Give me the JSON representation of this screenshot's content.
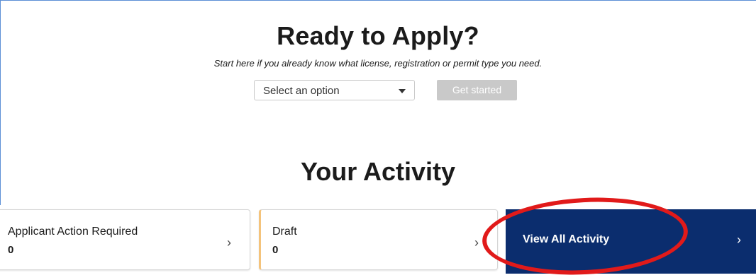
{
  "apply": {
    "title": "Ready to Apply?",
    "subtitle": "Start here if you already know what license, registration or permit type you need.",
    "select": {
      "value": "Select an option"
    },
    "get_started_label": "Get started"
  },
  "activity": {
    "title": "Your Activity",
    "cards": [
      {
        "label": "Applicant Action Required",
        "count": "0"
      },
      {
        "label": "Draft",
        "count": "0"
      }
    ],
    "view_all_label": "View All Activity",
    "view_all_color": "#0b2d6e"
  },
  "icons": {
    "chevron_right": "›",
    "dropdown": "chevron-down-icon"
  },
  "colors": {
    "annotation_ring": "#e11a1a",
    "draft_accent": "#f4c37b",
    "disabled_button": "#c9c9c9"
  }
}
